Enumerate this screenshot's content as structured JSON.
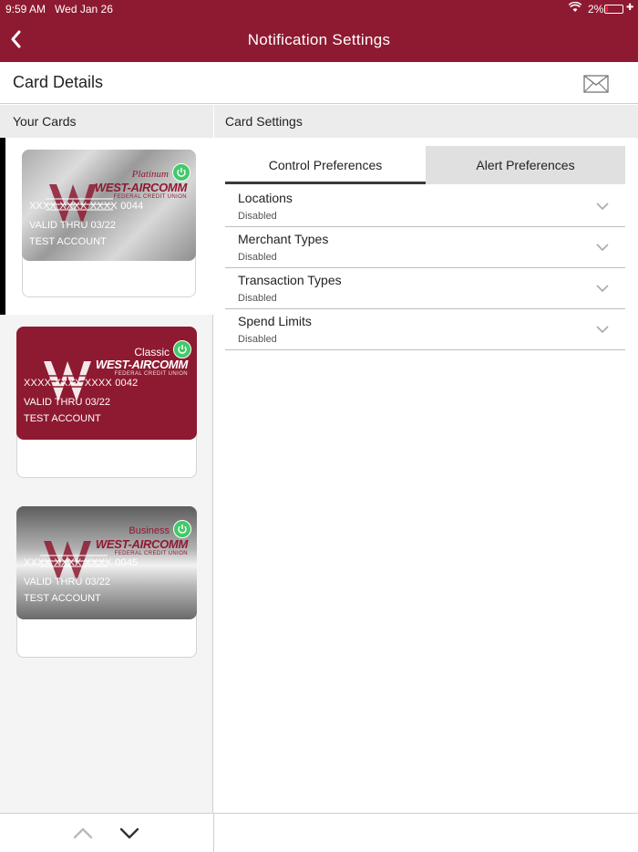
{
  "status_bar": {
    "time": "9:59 AM",
    "date": "Wed Jan 26",
    "battery": "2%"
  },
  "nav": {
    "title": "Notification Settings"
  },
  "card_details": {
    "label": "Card Details"
  },
  "left_pane": {
    "header": "Your Cards"
  },
  "cards": [
    {
      "tier": "Platinum",
      "brand": "WEST-AIRCOMM",
      "brand_sub": "FEDERAL CREDIT UNION",
      "number": "XXXX XXXX XXXX 0044",
      "valid": "VALID THRU 03/22",
      "account": "TEST ACCOUNT"
    },
    {
      "tier": "Classic",
      "brand": "WEST-AIRCOMM",
      "brand_sub": "FEDERAL CREDIT UNION",
      "number": "XXXX XXXX XXXX 0042",
      "valid": "VALID THRU 03/22",
      "account": "TEST ACCOUNT"
    },
    {
      "tier": "Business",
      "brand": "WEST-AIRCOMM",
      "brand_sub": "FEDERAL CREDIT UNION",
      "number": "XXXX XXXX XXXX 0045",
      "valid": "VALID THRU 03/22",
      "account": "TEST ACCOUNT"
    }
  ],
  "right_pane": {
    "header": "Card Settings",
    "tabs": {
      "control": "Control Preferences",
      "alert": "Alert Preferences"
    },
    "settings": [
      {
        "name": "Locations",
        "status": "Disabled"
      },
      {
        "name": "Merchant Types",
        "status": "Disabled"
      },
      {
        "name": "Transaction Types",
        "status": "Disabled"
      },
      {
        "name": "Spend Limits",
        "status": "Disabled"
      }
    ]
  },
  "colors": {
    "brand": "#8e1a31",
    "power": "#43c96a"
  }
}
